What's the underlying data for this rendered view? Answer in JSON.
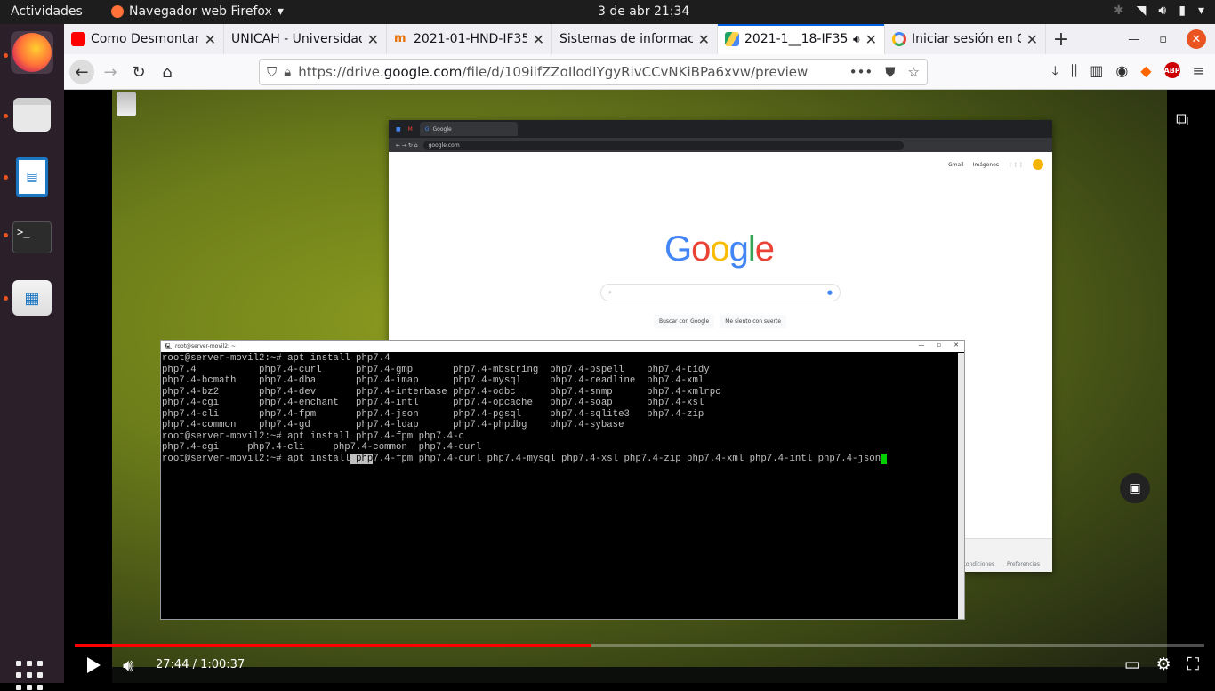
{
  "topbar": {
    "activities": "Actividades",
    "app_name": "Navegador web Firefox",
    "app_arrow": "▾",
    "clock": "3 de abr  21:34"
  },
  "dock": {
    "terminal_prompt": ">_"
  },
  "tabs": [
    {
      "title": "Como Desmontar y",
      "fav_color": "#ff0000"
    },
    {
      "title": "UNICAH - Universidad",
      "fav_color": ""
    },
    {
      "title": "2021-01-HND-IF35",
      "fav_color": "#e8710a"
    },
    {
      "title": "Sistemas de informació",
      "fav_color": ""
    },
    {
      "title": "2021-1__18-IF35",
      "fav_color": "#1fa463",
      "active": true
    },
    {
      "title": "Iniciar sesión en Go",
      "fav_color": "#4285f4"
    }
  ],
  "navbar": {
    "url_prefix": "https://drive.",
    "url_domain": "google.com",
    "url_suffix": "/file/d/109iifZZoIlodIYgyRivCCvNKiBPa6xvw/preview",
    "abp_label": "ABP"
  },
  "chrome": {
    "tab_title": "Google",
    "address": "google.com",
    "top_links": [
      "Gmail",
      "Imágenes"
    ],
    "logo_letters": [
      {
        "ch": "G",
        "color": "#4285f4"
      },
      {
        "ch": "o",
        "color": "#ea4335"
      },
      {
        "ch": "o",
        "color": "#fbbc05"
      },
      {
        "ch": "g",
        "color": "#4285f4"
      },
      {
        "ch": "l",
        "color": "#34a853"
      },
      {
        "ch": "e",
        "color": "#ea4335"
      }
    ],
    "button_search": "Buscar con Google",
    "button_lucky": "Me siento con suerte",
    "footer_links": [
      "Condiciones",
      "Preferencias"
    ]
  },
  "terminal": {
    "title": "root@server-movil2: ~",
    "lines": [
      "root@server-movil2:~# apt install php7.4",
      "php7.4           php7.4-curl      php7.4-gmp       php7.4-mbstring  php7.4-pspell    php7.4-tidy",
      "php7.4-bcmath    php7.4-dba       php7.4-imap      php7.4-mysql     php7.4-readline  php7.4-xml",
      "php7.4-bz2       php7.4-dev       php7.4-interbase php7.4-odbc      php7.4-snmp      php7.4-xmlrpc",
      "php7.4-cgi       php7.4-enchant   php7.4-intl      php7.4-opcache   php7.4-soap      php7.4-xsl",
      "php7.4-cli       php7.4-fpm       php7.4-json      php7.4-pgsql     php7.4-sqlite3   php7.4-zip",
      "php7.4-common    php7.4-gd        php7.4-ldap      php7.4-phpdbg    php7.4-sybase",
      "root@server-movil2:~# apt install php7.4-fpm php7.4-c",
      "php7.4-cgi     php7.4-cli     php7.4-common  php7.4-curl"
    ],
    "last_prefix": "root@server-movil2:~# apt install",
    "last_selected": " php",
    "last_suffix": "7.4-fpm php7.4-curl php7.4-mysql php7.4-xsl php7.4-zip php7.4-xml php7.4-intl php7.4-json",
    "cursor": " "
  },
  "player": {
    "time": "27:44 / 1:00:37",
    "progress": 0.4575
  }
}
